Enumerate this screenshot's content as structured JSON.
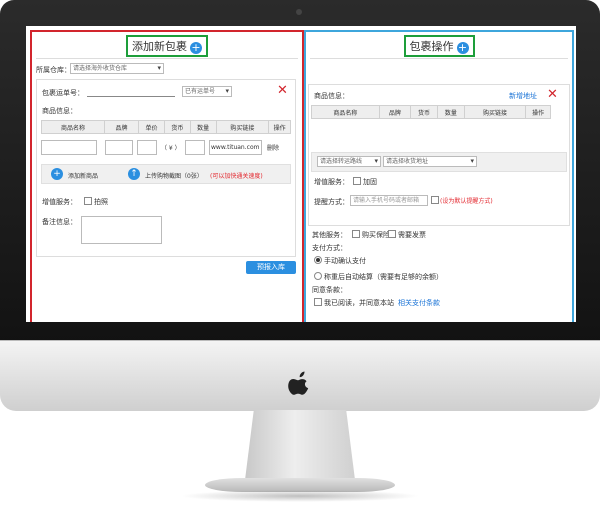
{
  "left": {
    "title": "添加新包裹",
    "warehouse_label": "所属仓库：",
    "warehouse_select": "请选择海外收货仓库",
    "tracking_label": "包裹运单号：",
    "tracking_select": "已有运单号",
    "goods_label": "商品信息：",
    "columns": [
      "商品名称",
      "品牌",
      "单价",
      "货币",
      "数量",
      "购买链接",
      "操作"
    ],
    "row": {
      "currency": "（ ¥ ）",
      "link": "www.tituan.com",
      "action": "删除"
    },
    "add_goods": "添加新商品",
    "upload_label": "上传购物截图（",
    "upload_count": "0",
    "upload_unit": "张）",
    "upload_hint": "(可以加快通关速度)",
    "value_service_label": "增值服务：",
    "photo_option": "拍照",
    "remark_label": "备注信息：",
    "submit_button": "预报入库"
  },
  "right": {
    "title": "包裹操作",
    "goods_label": "商品信息：",
    "add_address": "新增地址",
    "columns": [
      "商品名称",
      "品牌",
      "货币",
      "数量",
      "购买链接",
      "操作"
    ],
    "transit_select": "请选择转运路线",
    "address_select": "请选择收货地址",
    "value_service_label": "增值服务：",
    "reinforce_option": "加固",
    "reminder_label": "提醒方式：",
    "phone_placeholder": "请输入手机号码或者邮箱",
    "default_reminder": "设为默认提醒方式",
    "other_service_label": "其他服务：",
    "insurance_option": "购买保险",
    "invoice_option": "需要发票",
    "payment_label": "支付方式：",
    "payment_manual": "手动确认支付",
    "payment_auto": "称重后自动结算（需要有足够的余额）",
    "agreement_label": "同意条款：",
    "agree_text": "我已阅读，并同意本站",
    "agree_link": "相关支付条款"
  },
  "colors": {
    "left_border": "#d2252d",
    "right_border": "#3ea6dc",
    "title_border": "#1d9e3a",
    "accent": "#2b8fe0"
  }
}
